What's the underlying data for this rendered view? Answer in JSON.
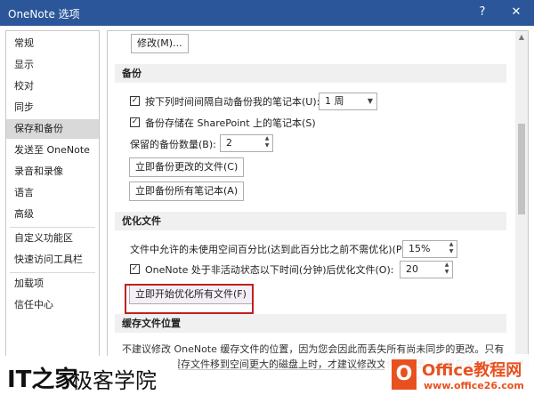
{
  "window": {
    "title": "OneNote 选项",
    "help_glyph": "?",
    "close_glyph": "✕"
  },
  "sidebar": {
    "items": [
      {
        "label": "常规"
      },
      {
        "label": "显示"
      },
      {
        "label": "校对"
      },
      {
        "label": "同步"
      },
      {
        "label": "保存和备份",
        "selected": true
      },
      {
        "label": "发送至 OneNote"
      },
      {
        "label": "录音和录像"
      },
      {
        "label": "语言"
      },
      {
        "label": "高级"
      },
      {
        "label": "自定义功能区"
      },
      {
        "label": "快速访问工具栏"
      },
      {
        "label": "加载项"
      },
      {
        "label": "信任中心"
      }
    ]
  },
  "content": {
    "modify_button": "修改(M)...",
    "backup": {
      "heading": "备份",
      "auto_backup_label": "按下列时间间隔自动备份我的笔记本(U):",
      "auto_backup_checked": true,
      "interval_value": "1 周",
      "sharepoint_label": "备份存储在 SharePoint 上的笔记本(S)",
      "sharepoint_checked": true,
      "count_label": "保留的备份数量(B):",
      "count_value": "2",
      "backup_changed_button": "立即备份更改的文件(C)",
      "backup_all_button": "立即备份所有笔记本(A)"
    },
    "optimize": {
      "heading": "优化文件",
      "unused_space_label": "文件中允许的未使用空间百分比(达到此百分比之前不需优化)(P):",
      "unused_space_value": "15%",
      "inactive_label": "OneNote 处于非活动状态以下时间(分钟)后优化文件(O):",
      "inactive_checked": true,
      "inactive_value": "20",
      "optimize_all_button": "立即开始优化所有文件(F)"
    },
    "cache": {
      "heading": "缓存文件位置",
      "paragraph_line1": "不建议修改 OneNote 缓存文件的位置，因为您会因此而丢失所有尚未同步的更改。只有",
      "paragraph_line2": "当您需要将缓存文件移到空间更大的磁盘上时，才建议修改文件的位置。此缓存文件应"
    }
  },
  "watermark": {
    "logo_text": "IT之家",
    "site_text": "极客学院"
  },
  "office_badge": {
    "icon_letter": "O",
    "title": "Office教程网",
    "url": "www.office26.com"
  },
  "colors": {
    "titlebar": "#2b579a",
    "highlight": "#c0201f",
    "office_orange": "#e8511f"
  }
}
